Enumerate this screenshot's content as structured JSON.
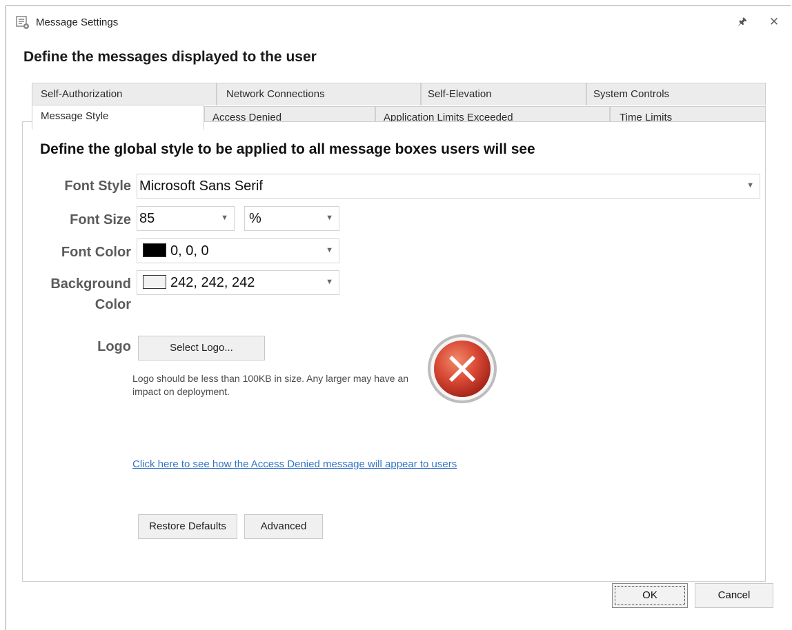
{
  "window": {
    "title": "Message Settings"
  },
  "heading": "Define the messages displayed to the user",
  "tabs_back_row": [
    "Self-Authorization",
    "Network Connections",
    "Self-Elevation",
    "System Controls"
  ],
  "tabs_front_row": [
    "Message Style",
    "Access Denied",
    "Application Limits Exceeded",
    "Time Limits"
  ],
  "active_tab": "Message Style",
  "section_title": "Define the global style to be applied to all message boxes users will see",
  "font_style": {
    "label": "Font Style",
    "value": "Microsoft Sans Serif"
  },
  "font_size": {
    "label": "Font Size",
    "value": "85",
    "unit": "%"
  },
  "font_color": {
    "label": "Font Color",
    "value": "0, 0, 0",
    "swatch": "#000000"
  },
  "background_color": {
    "label_line1": "Background",
    "label_line2": "Color",
    "value": "242, 242, 242",
    "swatch": "#f2f2f2"
  },
  "logo": {
    "label": "Logo",
    "button": "Select Logo...",
    "note": "Logo should be less than 100KB in size. Any larger may have an impact on deployment.",
    "icon": "error-x-icon"
  },
  "preview_link": "Click here to see how the Access Denied message will appear to users",
  "buttons": {
    "restore_defaults": "Restore Defaults",
    "advanced": "Advanced",
    "ok": "OK",
    "cancel": "Cancel"
  },
  "colors": {
    "link": "#3174c4",
    "error_red": "#d94a36",
    "label_gray": "#5b5b5b"
  }
}
